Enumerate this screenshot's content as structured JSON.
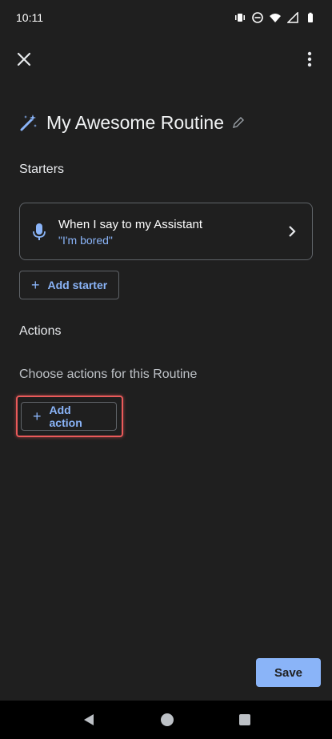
{
  "status_bar": {
    "time": "10:11"
  },
  "routine": {
    "title": "My Awesome Routine"
  },
  "starters": {
    "label": "Starters",
    "card": {
      "title": "When I say to my Assistant",
      "subtitle": "\"I'm bored\""
    },
    "add_label": "Add starter"
  },
  "actions": {
    "label": "Actions",
    "helper": "Choose actions for this Routine",
    "add_label": "Add action"
  },
  "footer": {
    "save_label": "Save"
  },
  "colors": {
    "accent": "#8ab4f8",
    "background": "#1f1f1f",
    "highlight": "#ea5a5a"
  }
}
